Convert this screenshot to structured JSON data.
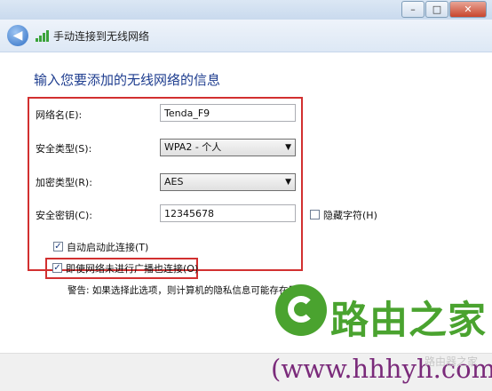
{
  "window": {
    "minimize": "–",
    "maximize": "□",
    "close": "✕",
    "nav_title": "手动连接到无线网络"
  },
  "form": {
    "heading": "输入您要添加的无线网络的信息",
    "network_name_label": "网络名(E):",
    "network_name_value": "Tenda_F9",
    "security_type_label": "安全类型(S):",
    "security_type_value": "WPA2 - 个人",
    "encryption_type_label": "加密类型(R):",
    "encryption_type_value": "AES",
    "security_key_label": "安全密钥(C):",
    "security_key_value": "12345678",
    "hide_chars_label": "隐藏字符(H)",
    "auto_connect_label": "自动启动此连接(T)",
    "connect_hidden_label": "即使网络未进行广播也连接(O)",
    "warning": "警告: 如果选择此选项，则计算机的隐私信息可能存在风险。"
  },
  "watermark": {
    "brand": "路由之家",
    "url": "(www.hhhyh.com",
    "faint": "路由器之家"
  },
  "colors": {
    "highlight_box": "#d23030",
    "heading": "#1e3d8f",
    "brand_green": "#4aa32f",
    "url_purple": "#7a2a7a"
  }
}
